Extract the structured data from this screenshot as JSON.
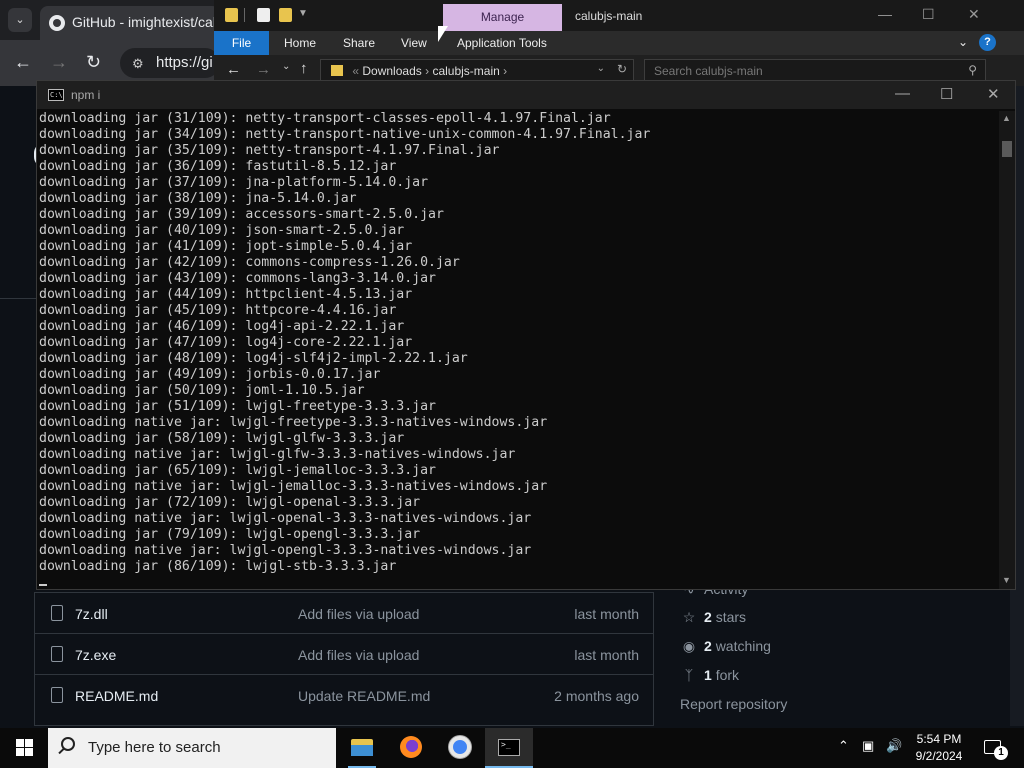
{
  "browser": {
    "tab_title": "GitHub - imightexist/calub",
    "address_partial": "https://gi",
    "tab_dropdown_icon": "chevron-down-icon"
  },
  "github": {
    "files": [
      {
        "name": "7z.dll",
        "message": "Add files via upload",
        "date": "last month"
      },
      {
        "name": "7z.exe",
        "message": "Add files via upload",
        "date": "last month"
      },
      {
        "name": "README.md",
        "message": "Update README.md",
        "date": "2 months ago"
      }
    ],
    "about": {
      "activity": "Activity",
      "stars_count": "2",
      "stars_label": "stars",
      "watching_count": "2",
      "watching_label": "watching",
      "fork_count": "1",
      "fork_label": "fork",
      "report": "Report repository"
    }
  },
  "explorer": {
    "manage_tab": "Manage",
    "window_title": "calubjs-main",
    "ribbon": {
      "file": "File",
      "home": "Home",
      "share": "Share",
      "view": "View",
      "app_tools": "Application Tools"
    },
    "path_root": "Downloads",
    "path_folder": "calubjs-main",
    "search_placeholder": "Search calubjs-main"
  },
  "terminal": {
    "title": "npm i",
    "lines": [
      "downloading jar (31/109): netty-transport-classes-epoll-4.1.97.Final.jar",
      "downloading jar (34/109): netty-transport-native-unix-common-4.1.97.Final.jar",
      "downloading jar (35/109): netty-transport-4.1.97.Final.jar",
      "downloading jar (36/109): fastutil-8.5.12.jar",
      "downloading jar (37/109): jna-platform-5.14.0.jar",
      "downloading jar (38/109): jna-5.14.0.jar",
      "downloading jar (39/109): accessors-smart-2.5.0.jar",
      "downloading jar (40/109): json-smart-2.5.0.jar",
      "downloading jar (41/109): jopt-simple-5.0.4.jar",
      "downloading jar (42/109): commons-compress-1.26.0.jar",
      "downloading jar (43/109): commons-lang3-3.14.0.jar",
      "downloading jar (44/109): httpclient-4.5.13.jar",
      "downloading jar (45/109): httpcore-4.4.16.jar",
      "downloading jar (46/109): log4j-api-2.22.1.jar",
      "downloading jar (47/109): log4j-core-2.22.1.jar",
      "downloading jar (48/109): log4j-slf4j2-impl-2.22.1.jar",
      "downloading jar (49/109): jorbis-0.0.17.jar",
      "downloading jar (50/109): joml-1.10.5.jar",
      "downloading jar (51/109): lwjgl-freetype-3.3.3.jar",
      "downloading native jar: lwjgl-freetype-3.3.3-natives-windows.jar",
      "downloading jar (58/109): lwjgl-glfw-3.3.3.jar",
      "downloading native jar: lwjgl-glfw-3.3.3-natives-windows.jar",
      "downloading jar (65/109): lwjgl-jemalloc-3.3.3.jar",
      "downloading native jar: lwjgl-jemalloc-3.3.3-natives-windows.jar",
      "downloading jar (72/109): lwjgl-openal-3.3.3.jar",
      "downloading native jar: lwjgl-openal-3.3.3-natives-windows.jar",
      "downloading jar (79/109): lwjgl-opengl-3.3.3.jar",
      "downloading native jar: lwjgl-opengl-3.3.3-natives-windows.jar",
      "downloading jar (86/109): lwjgl-stb-3.3.3.jar"
    ]
  },
  "taskbar": {
    "search_placeholder": "Type here to search",
    "apps": [
      "file-explorer-icon",
      "firefox-icon",
      "chrome-icon",
      "terminal-icon"
    ],
    "time": "5:54 PM",
    "date": "9/2/2024",
    "notification_count": "1"
  }
}
